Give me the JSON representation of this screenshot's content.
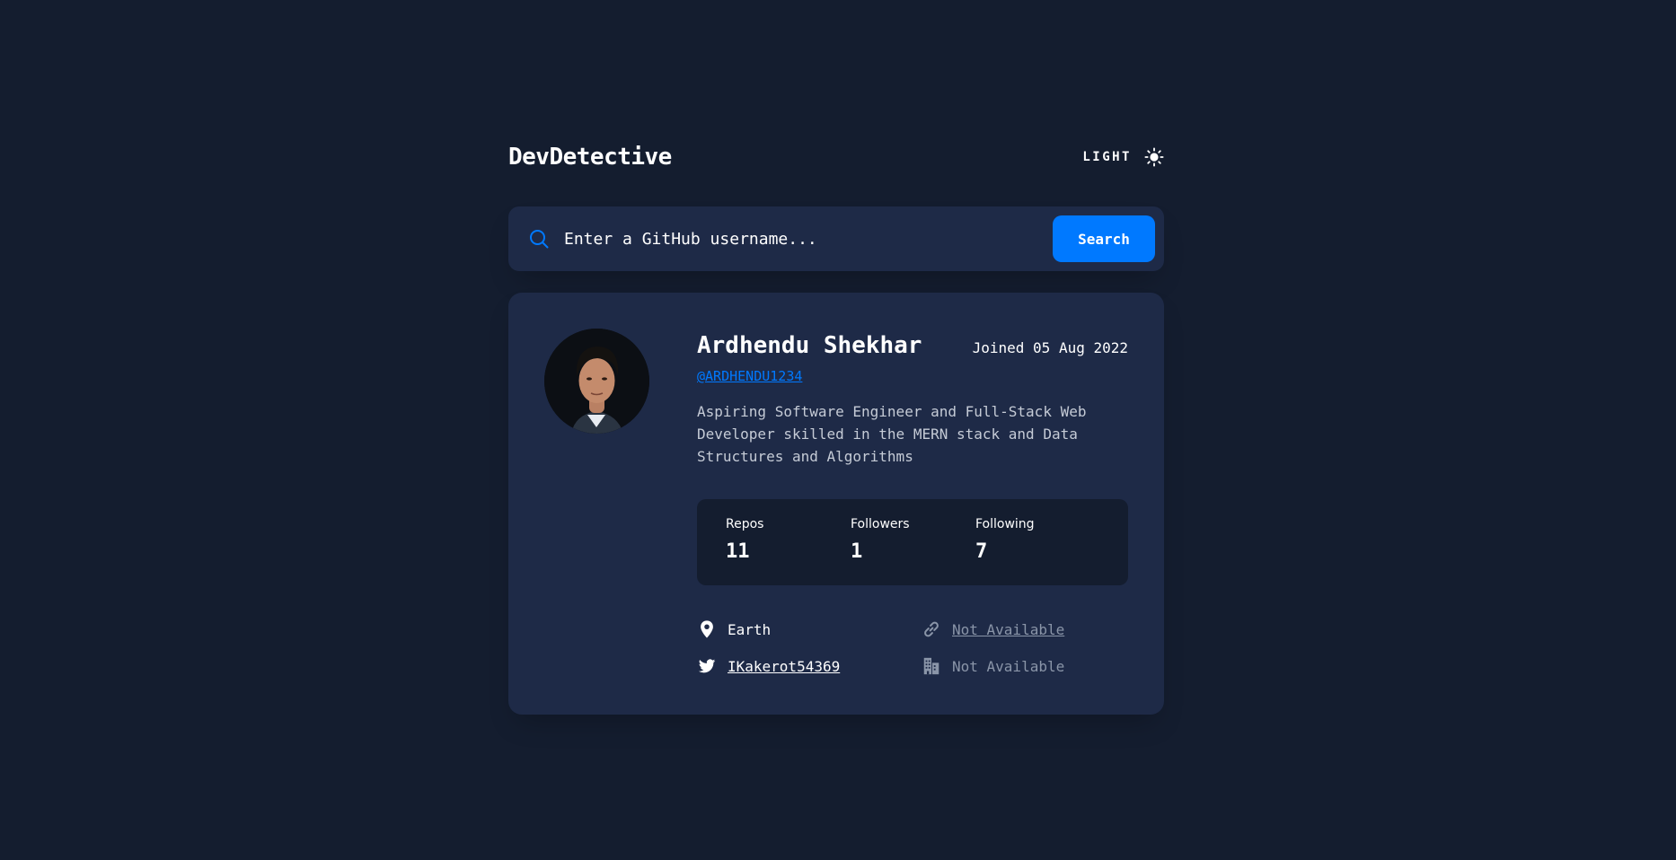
{
  "app": {
    "title": "DevDetective"
  },
  "theme_toggle": {
    "label": "LIGHT",
    "icon": "sun-icon"
  },
  "search": {
    "placeholder": "Enter a GitHub username...",
    "button_label": "Search",
    "icon": "search-icon"
  },
  "profile": {
    "name": "Ardhendu Shekhar",
    "joined": "Joined 05 Aug 2022",
    "handle": "@ARDHENDU1234",
    "bio": "Aspiring Software Engineer and Full-Stack Web Developer skilled in the MERN stack and Data Structures and Algorithms",
    "stats": [
      {
        "label": "Repos",
        "value": "11"
      },
      {
        "label": "Followers",
        "value": "1"
      },
      {
        "label": "Following",
        "value": "7"
      }
    ],
    "info": {
      "location": "Earth",
      "website": "Not Available",
      "twitter": "IKakerot54369",
      "company": "Not Available"
    }
  },
  "colors": {
    "background": "#141d2f",
    "card": "#1e2a47",
    "accent": "#0079ff",
    "muted": "#8a95a8"
  }
}
